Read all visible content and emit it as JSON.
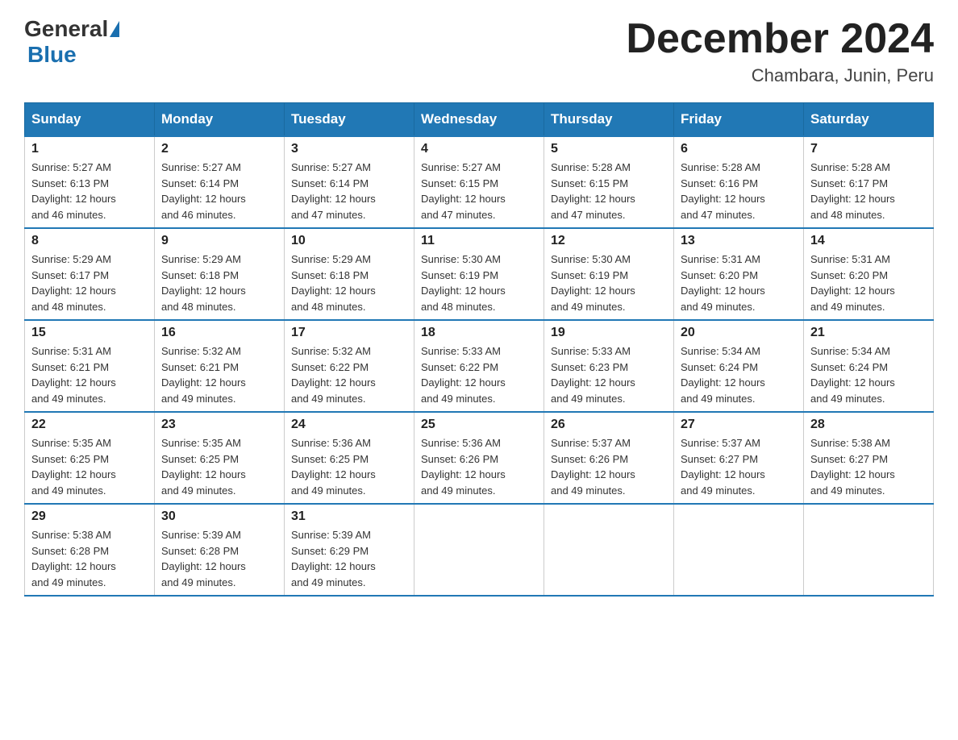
{
  "logo": {
    "general": "General",
    "blue": "Blue"
  },
  "title": "December 2024",
  "location": "Chambara, Junin, Peru",
  "headers": [
    "Sunday",
    "Monday",
    "Tuesday",
    "Wednesday",
    "Thursday",
    "Friday",
    "Saturday"
  ],
  "weeks": [
    [
      {
        "day": "1",
        "sunrise": "5:27 AM",
        "sunset": "6:13 PM",
        "daylight": "12 hours and 46 minutes."
      },
      {
        "day": "2",
        "sunrise": "5:27 AM",
        "sunset": "6:14 PM",
        "daylight": "12 hours and 46 minutes."
      },
      {
        "day": "3",
        "sunrise": "5:27 AM",
        "sunset": "6:14 PM",
        "daylight": "12 hours and 47 minutes."
      },
      {
        "day": "4",
        "sunrise": "5:27 AM",
        "sunset": "6:15 PM",
        "daylight": "12 hours and 47 minutes."
      },
      {
        "day": "5",
        "sunrise": "5:28 AM",
        "sunset": "6:15 PM",
        "daylight": "12 hours and 47 minutes."
      },
      {
        "day": "6",
        "sunrise": "5:28 AM",
        "sunset": "6:16 PM",
        "daylight": "12 hours and 47 minutes."
      },
      {
        "day": "7",
        "sunrise": "5:28 AM",
        "sunset": "6:17 PM",
        "daylight": "12 hours and 48 minutes."
      }
    ],
    [
      {
        "day": "8",
        "sunrise": "5:29 AM",
        "sunset": "6:17 PM",
        "daylight": "12 hours and 48 minutes."
      },
      {
        "day": "9",
        "sunrise": "5:29 AM",
        "sunset": "6:18 PM",
        "daylight": "12 hours and 48 minutes."
      },
      {
        "day": "10",
        "sunrise": "5:29 AM",
        "sunset": "6:18 PM",
        "daylight": "12 hours and 48 minutes."
      },
      {
        "day": "11",
        "sunrise": "5:30 AM",
        "sunset": "6:19 PM",
        "daylight": "12 hours and 48 minutes."
      },
      {
        "day": "12",
        "sunrise": "5:30 AM",
        "sunset": "6:19 PM",
        "daylight": "12 hours and 49 minutes."
      },
      {
        "day": "13",
        "sunrise": "5:31 AM",
        "sunset": "6:20 PM",
        "daylight": "12 hours and 49 minutes."
      },
      {
        "day": "14",
        "sunrise": "5:31 AM",
        "sunset": "6:20 PM",
        "daylight": "12 hours and 49 minutes."
      }
    ],
    [
      {
        "day": "15",
        "sunrise": "5:31 AM",
        "sunset": "6:21 PM",
        "daylight": "12 hours and 49 minutes."
      },
      {
        "day": "16",
        "sunrise": "5:32 AM",
        "sunset": "6:21 PM",
        "daylight": "12 hours and 49 minutes."
      },
      {
        "day": "17",
        "sunrise": "5:32 AM",
        "sunset": "6:22 PM",
        "daylight": "12 hours and 49 minutes."
      },
      {
        "day": "18",
        "sunrise": "5:33 AM",
        "sunset": "6:22 PM",
        "daylight": "12 hours and 49 minutes."
      },
      {
        "day": "19",
        "sunrise": "5:33 AM",
        "sunset": "6:23 PM",
        "daylight": "12 hours and 49 minutes."
      },
      {
        "day": "20",
        "sunrise": "5:34 AM",
        "sunset": "6:24 PM",
        "daylight": "12 hours and 49 minutes."
      },
      {
        "day": "21",
        "sunrise": "5:34 AM",
        "sunset": "6:24 PM",
        "daylight": "12 hours and 49 minutes."
      }
    ],
    [
      {
        "day": "22",
        "sunrise": "5:35 AM",
        "sunset": "6:25 PM",
        "daylight": "12 hours and 49 minutes."
      },
      {
        "day": "23",
        "sunrise": "5:35 AM",
        "sunset": "6:25 PM",
        "daylight": "12 hours and 49 minutes."
      },
      {
        "day": "24",
        "sunrise": "5:36 AM",
        "sunset": "6:25 PM",
        "daylight": "12 hours and 49 minutes."
      },
      {
        "day": "25",
        "sunrise": "5:36 AM",
        "sunset": "6:26 PM",
        "daylight": "12 hours and 49 minutes."
      },
      {
        "day": "26",
        "sunrise": "5:37 AM",
        "sunset": "6:26 PM",
        "daylight": "12 hours and 49 minutes."
      },
      {
        "day": "27",
        "sunrise": "5:37 AM",
        "sunset": "6:27 PM",
        "daylight": "12 hours and 49 minutes."
      },
      {
        "day": "28",
        "sunrise": "5:38 AM",
        "sunset": "6:27 PM",
        "daylight": "12 hours and 49 minutes."
      }
    ],
    [
      {
        "day": "29",
        "sunrise": "5:38 AM",
        "sunset": "6:28 PM",
        "daylight": "12 hours and 49 minutes."
      },
      {
        "day": "30",
        "sunrise": "5:39 AM",
        "sunset": "6:28 PM",
        "daylight": "12 hours and 49 minutes."
      },
      {
        "day": "31",
        "sunrise": "5:39 AM",
        "sunset": "6:29 PM",
        "daylight": "12 hours and 49 minutes."
      },
      null,
      null,
      null,
      null
    ]
  ],
  "labels": {
    "sunrise": "Sunrise:",
    "sunset": "Sunset:",
    "daylight": "Daylight:"
  }
}
